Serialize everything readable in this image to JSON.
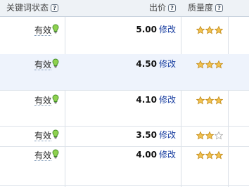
{
  "header": {
    "status_label": "关键词状态",
    "bid_label": "出价",
    "quality_label": "质量度",
    "help_glyph": "?"
  },
  "rows": [
    {
      "status": "有效",
      "bid": "5.00",
      "action": "修改",
      "quality_stars": 3,
      "max_stars": 3
    },
    {
      "status": "有效",
      "bid": "4.50",
      "action": "修改",
      "quality_stars": 3,
      "max_stars": 3,
      "highlighted": true
    },
    {
      "status": "有效",
      "bid": "4.10",
      "action": "修改",
      "quality_stars": 3,
      "max_stars": 3
    },
    {
      "status": "有效",
      "bid": "3.50",
      "action": "修改",
      "quality_stars": 2,
      "max_stars": 3
    },
    {
      "status": "有效",
      "bid": "4.00",
      "action": "修改",
      "quality_stars": 3,
      "max_stars": 3
    }
  ],
  "colors": {
    "header_bg": "#eef2f6",
    "highlight_row": "#eef3fc",
    "link": "#1a3fa0",
    "star_filled": "#f2c14e",
    "star_empty": "#ffffff",
    "bulb": "#8fd14f"
  },
  "icons": {
    "help": "help-icon",
    "status": "lightbulb-icon",
    "quality": "star-icon"
  }
}
